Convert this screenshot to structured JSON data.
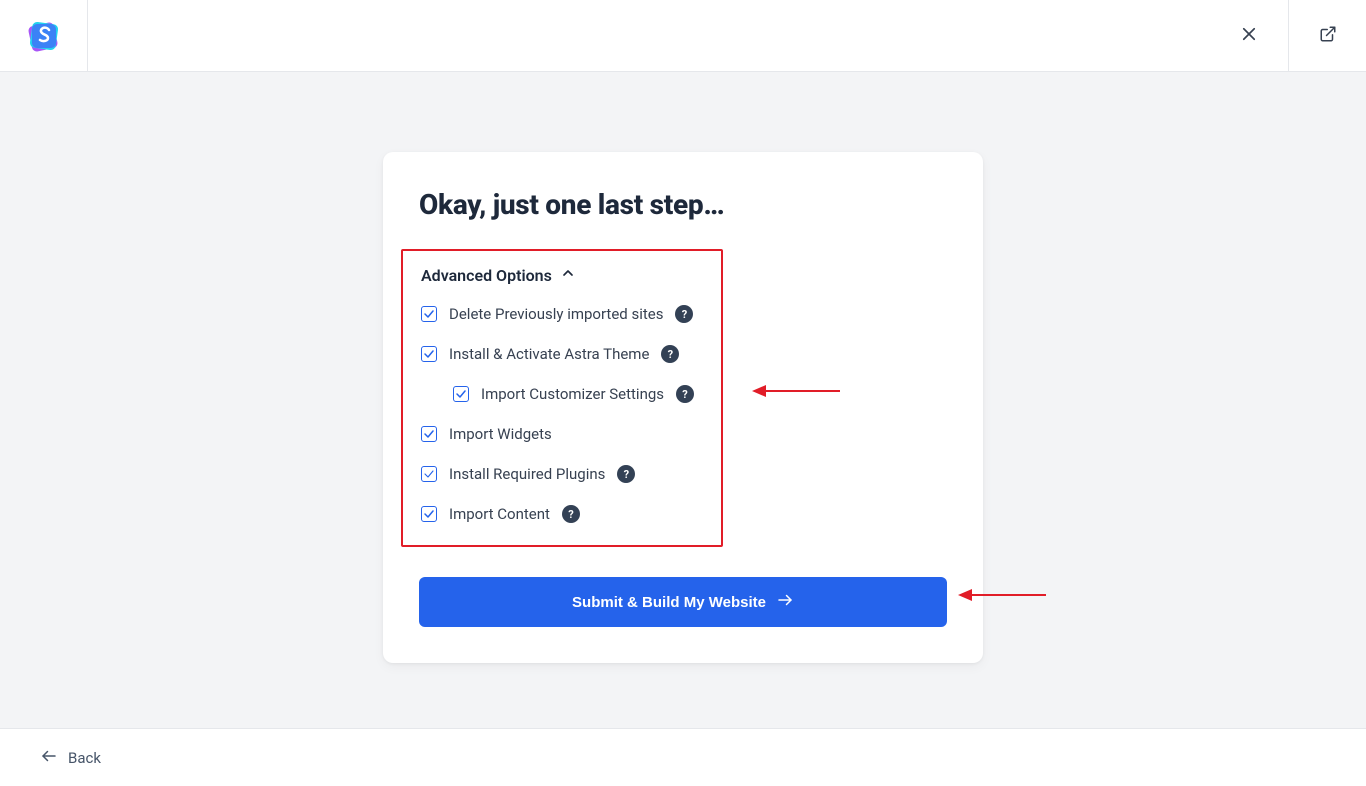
{
  "header": {
    "title": "Okay, just one last step…"
  },
  "advanced": {
    "toggle_label": "Advanced Options",
    "options": {
      "delete_prev": {
        "label": "Delete Previously imported sites",
        "help": true,
        "indent": false
      },
      "install_astra": {
        "label": "Install & Activate Astra Theme",
        "help": true,
        "indent": false
      },
      "import_cust": {
        "label": "Import Customizer Settings",
        "help": true,
        "indent": true
      },
      "import_widgets": {
        "label": "Import Widgets",
        "help": false,
        "indent": false
      },
      "install_plugins": {
        "label": "Install Required Plugins",
        "help": true,
        "indent": false
      },
      "import_content": {
        "label": "Import Content",
        "help": true,
        "indent": false
      }
    }
  },
  "submit_label": "Submit & Build My Website",
  "footer": {
    "back_label": "Back"
  },
  "help_glyph": "?"
}
